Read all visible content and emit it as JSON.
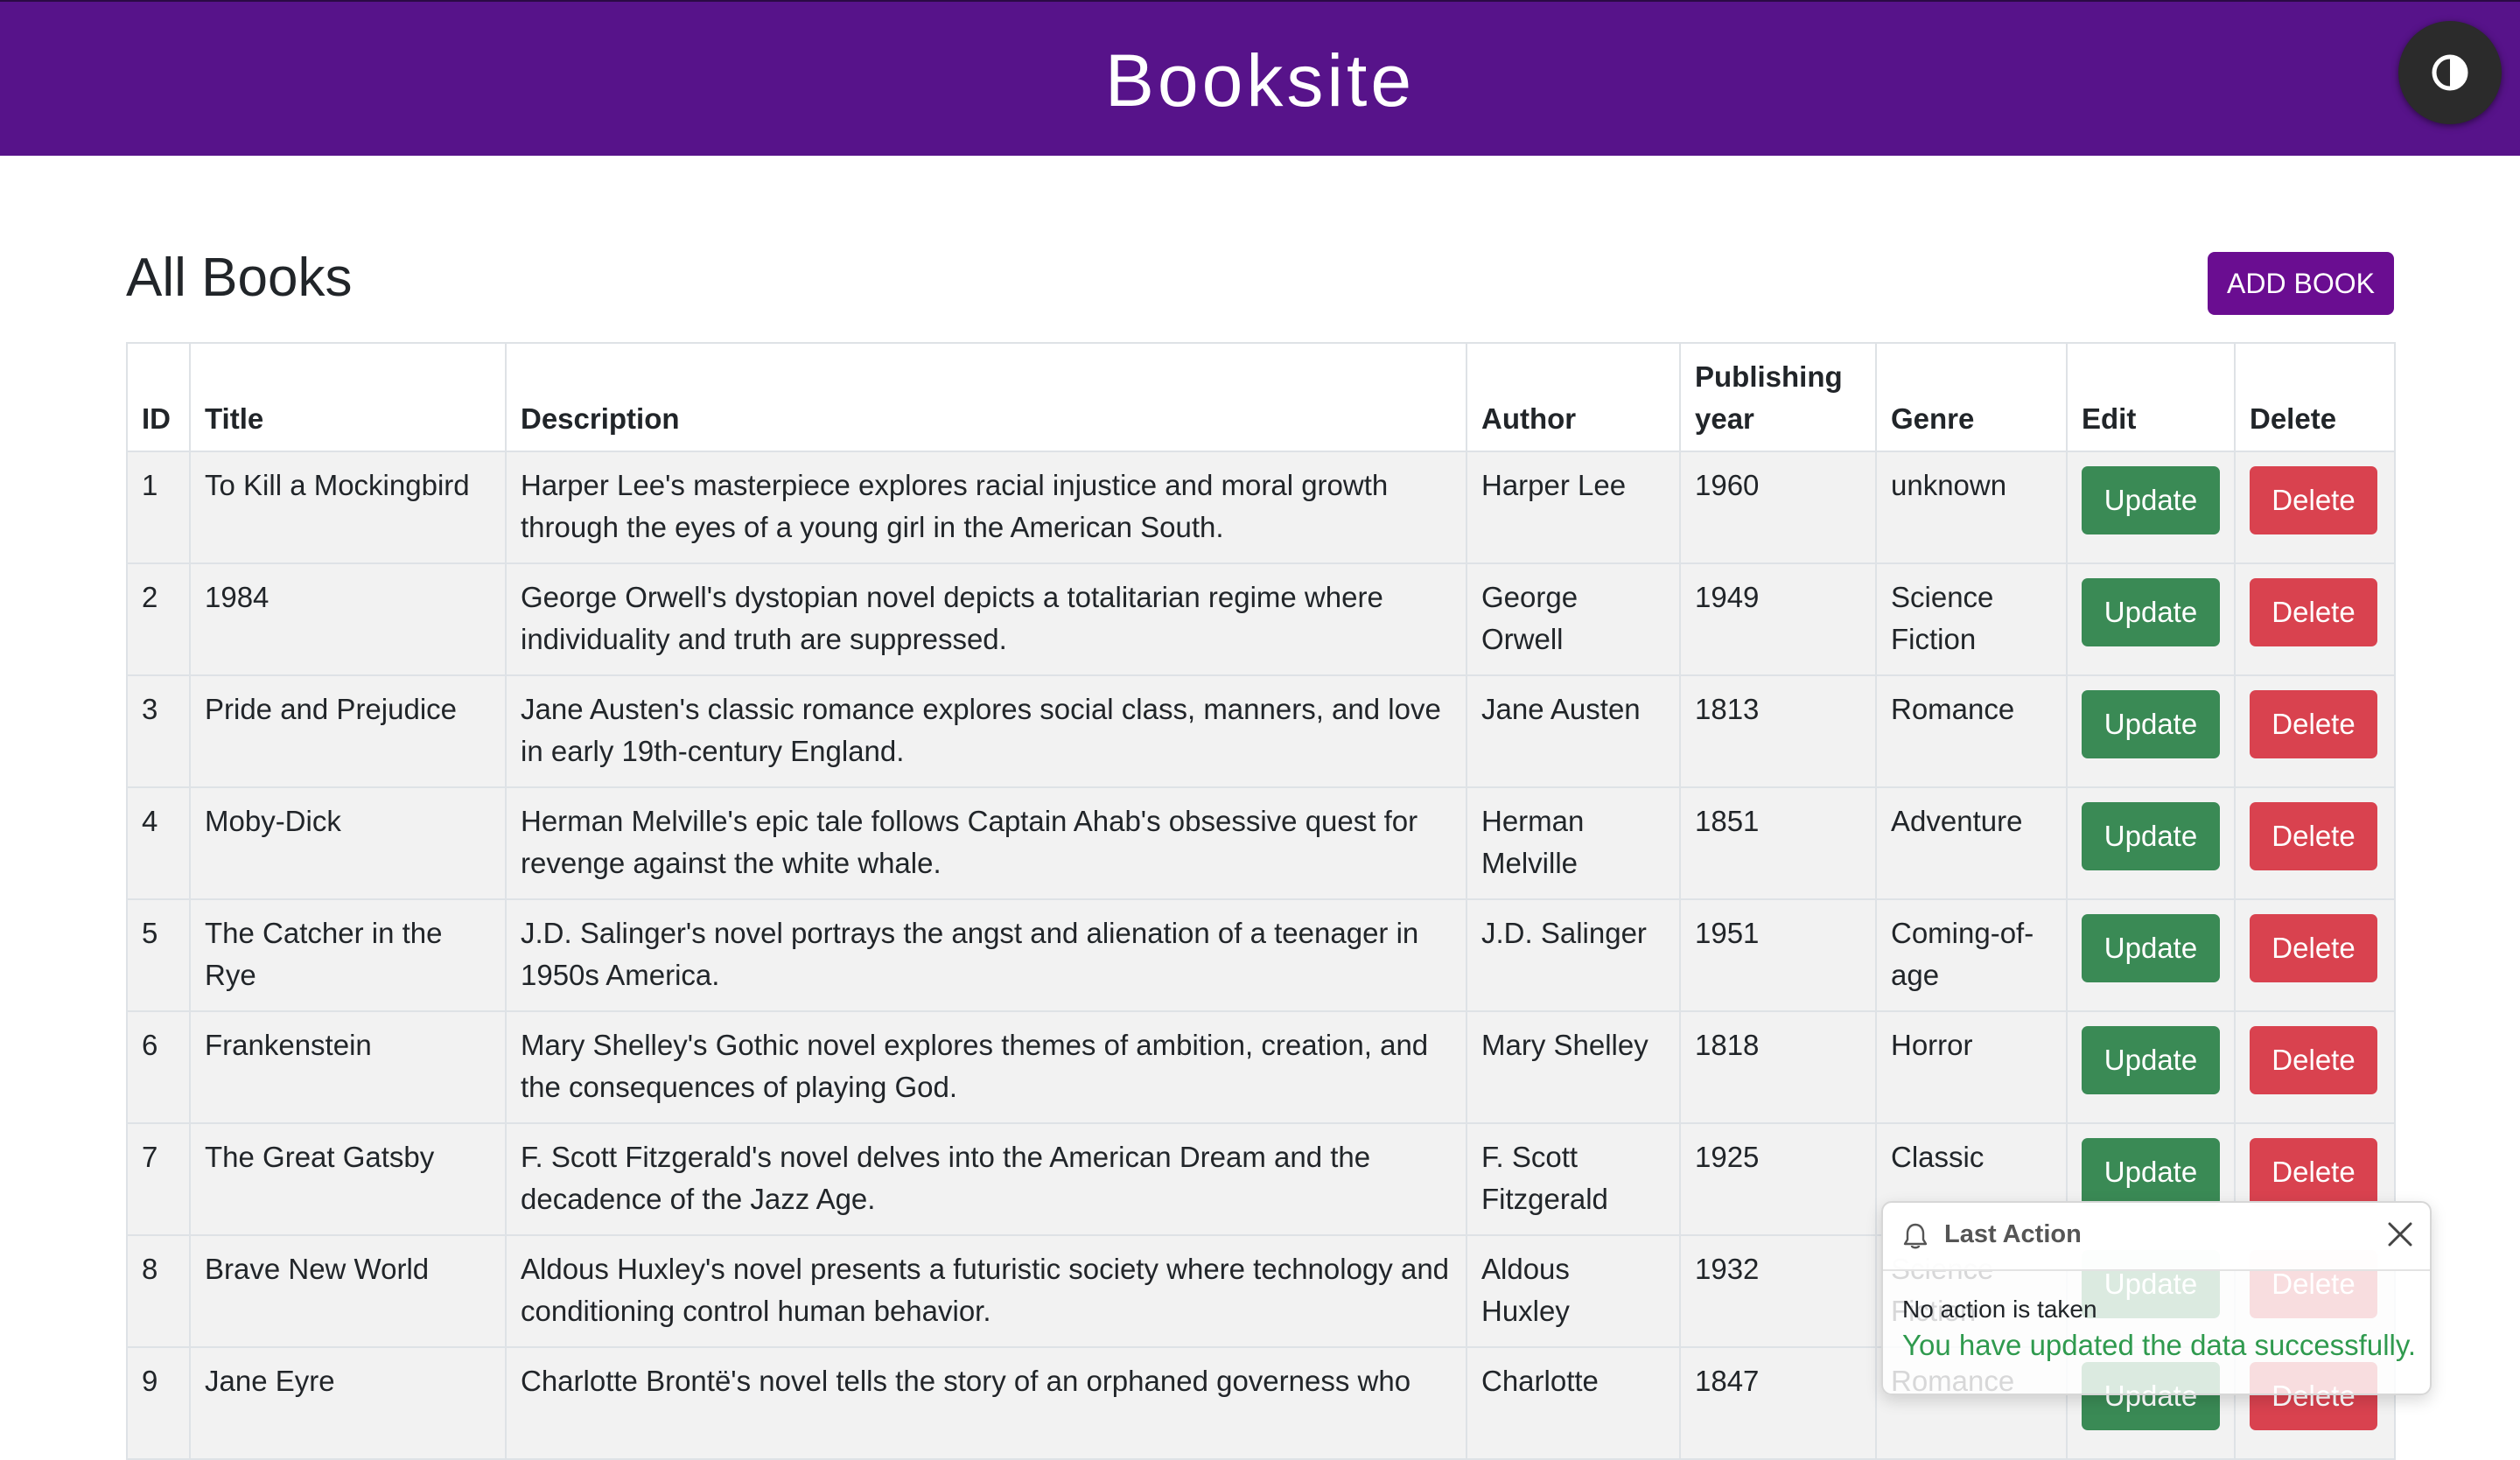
{
  "header": {
    "brand": "Booksite",
    "theme_toggle_icon": "contrast-icon"
  },
  "main": {
    "title": "All Books",
    "add_button": "ADD BOOK"
  },
  "table": {
    "columns": [
      "ID",
      "Title",
      "Description",
      "Author",
      "Publishing year",
      "Genre",
      "Edit",
      "Delete"
    ],
    "update_label": "Update",
    "delete_label": "Delete",
    "rows": [
      {
        "id": "1",
        "title": "To Kill a Mockingbird",
        "description": "Harper Lee's masterpiece explores racial injustice and moral growth through the eyes of a young girl in the American South.",
        "author": "Harper Lee",
        "year": "1960",
        "genre": "unknown"
      },
      {
        "id": "2",
        "title": "1984",
        "description": "George Orwell's dystopian novel depicts a totalitarian regime where individuality and truth are suppressed.",
        "author": "George Orwell",
        "year": "1949",
        "genre": "Science Fiction"
      },
      {
        "id": "3",
        "title": "Pride and Prejudice",
        "description": "Jane Austen's classic romance explores social class, manners, and love in early 19th-century England.",
        "author": "Jane Austen",
        "year": "1813",
        "genre": "Romance"
      },
      {
        "id": "4",
        "title": "Moby-Dick",
        "description": "Herman Melville's epic tale follows Captain Ahab's obsessive quest for revenge against the white whale.",
        "author": "Herman Melville",
        "year": "1851",
        "genre": "Adventure"
      },
      {
        "id": "5",
        "title": "The Catcher in the Rye",
        "description": "J.D. Salinger's novel portrays the angst and alienation of a teenager in 1950s America.",
        "author": "J.D. Salinger",
        "year": "1951",
        "genre": "Coming-of-age"
      },
      {
        "id": "6",
        "title": "Frankenstein",
        "description": "Mary Shelley's Gothic novel explores themes of ambition, creation, and the consequences of playing God.",
        "author": "Mary Shelley",
        "year": "1818",
        "genre": "Horror"
      },
      {
        "id": "7",
        "title": "The Great Gatsby",
        "description": "F. Scott Fitzgerald's novel delves into the American Dream and the decadence of the Jazz Age.",
        "author": "F. Scott Fitzgerald",
        "year": "1925",
        "genre": "Classic"
      },
      {
        "id": "8",
        "title": "Brave New World",
        "description": "Aldous Huxley's novel presents a futuristic society where technology and conditioning control human behavior.",
        "author": "Aldous Huxley",
        "year": "1932",
        "genre": "Science Fiction"
      },
      {
        "id": "9",
        "title": "Jane Eyre",
        "description": "Charlotte Brontë's novel tells the story of an orphaned governess who",
        "author": "Charlotte",
        "year": "1847",
        "genre": "Romance"
      }
    ]
  },
  "toast": {
    "title": "Last Action",
    "icon": "bell-icon",
    "close_icon": "close-icon",
    "line1": "No action is taken",
    "line2": "You have updated the data successfully."
  },
  "colors": {
    "header_bg": "#57138a",
    "add_button_bg": "#6a0d91",
    "update_button_bg": "#3a8a55",
    "delete_button_bg": "#d9424f",
    "success_text": "#2f9a4e"
  }
}
